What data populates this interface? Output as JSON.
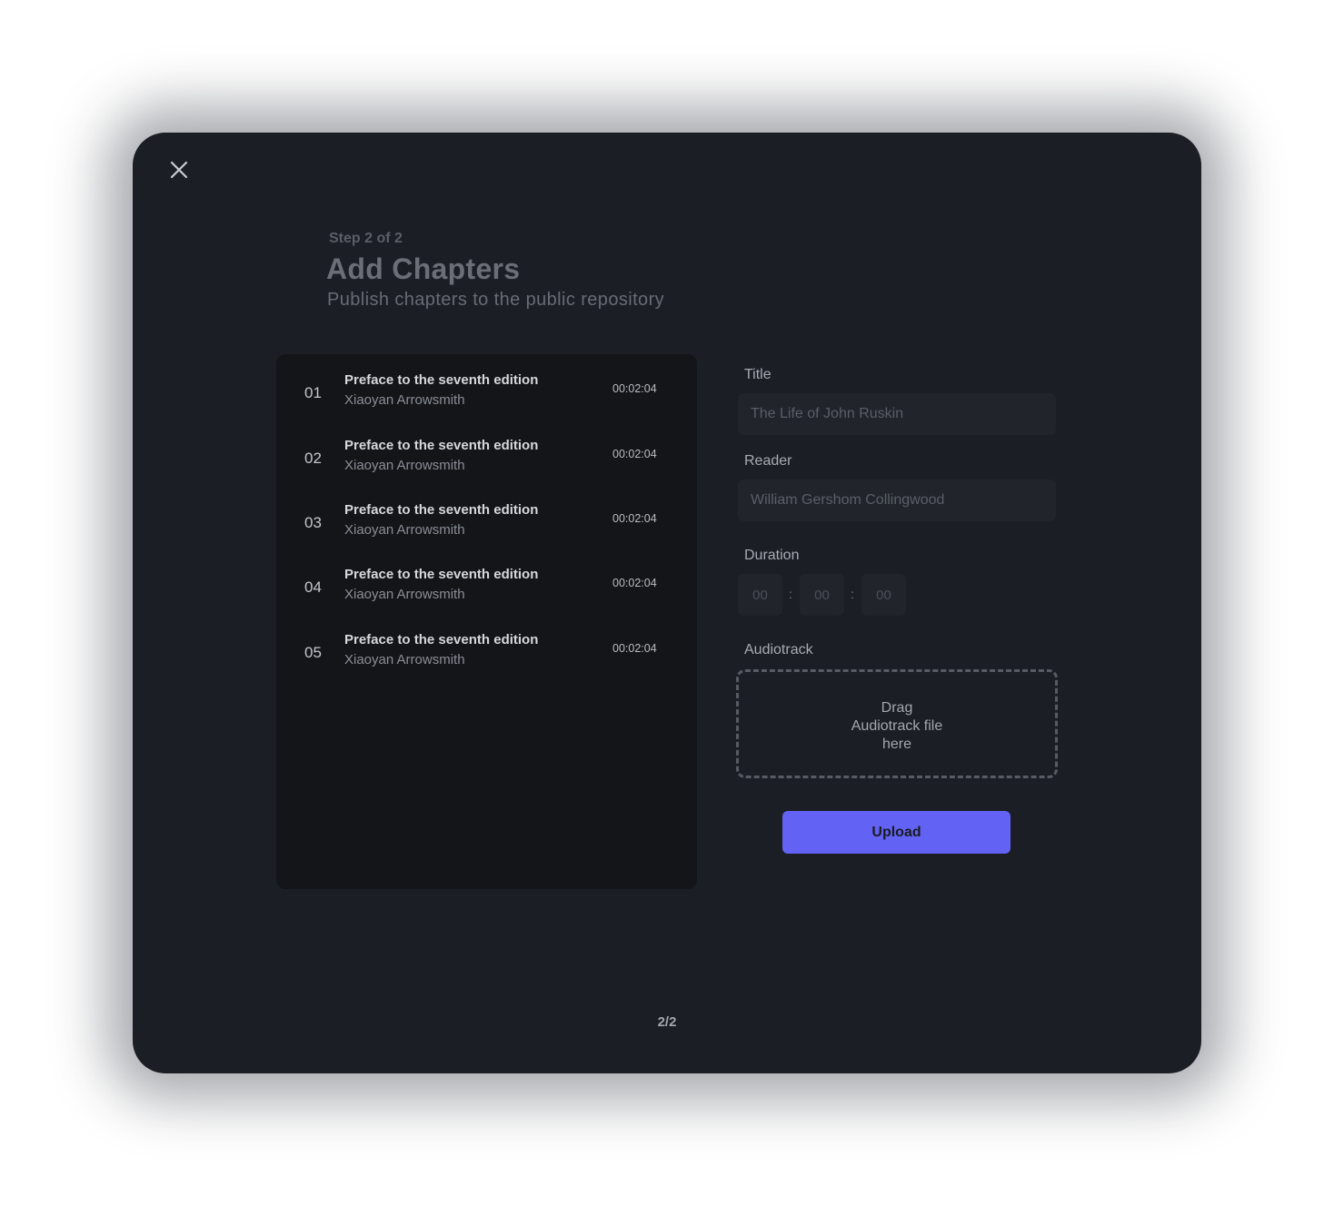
{
  "header": {
    "step": "Step 2 of 2",
    "title": "Add Chapters",
    "subtitle": "Publish chapters to the public repository"
  },
  "chapters": [
    {
      "number": "01",
      "title": "Preface to the seventh edition",
      "reader": "Xiaoyan Arrowsmith",
      "duration": "00:02:04"
    },
    {
      "number": "02",
      "title": "Preface to the seventh edition",
      "reader": "Xiaoyan Arrowsmith",
      "duration": "00:02:04"
    },
    {
      "number": "03",
      "title": "Preface to the seventh edition",
      "reader": "Xiaoyan Arrowsmith",
      "duration": "00:02:04"
    },
    {
      "number": "04",
      "title": "Preface to the seventh edition",
      "reader": "Xiaoyan Arrowsmith",
      "duration": "00:02:04"
    },
    {
      "number": "05",
      "title": "Preface to the seventh edition",
      "reader": "Xiaoyan Arrowsmith",
      "duration": "00:02:04"
    }
  ],
  "form": {
    "title_label": "Title",
    "title_placeholder": "The Life of John Ruskin",
    "reader_label": "Reader",
    "reader_placeholder": "William Gershom Collingwood",
    "duration_label": "Duration",
    "duration_hours_placeholder": "00",
    "duration_minutes_placeholder": "00",
    "duration_seconds_placeholder": "00",
    "duration_separator": ":",
    "audiotrack_label": "Audiotrack",
    "dropzone_line1": "Drag",
    "dropzone_line2": "Audiotrack file",
    "dropzone_line3": "here",
    "upload_label": "Upload"
  },
  "pagination": {
    "text": "2/2"
  },
  "colors": {
    "modal_background": "#1b1e25",
    "list_background": "#131519",
    "accent": "#6262f4"
  },
  "icons": {
    "close": "close-icon"
  }
}
